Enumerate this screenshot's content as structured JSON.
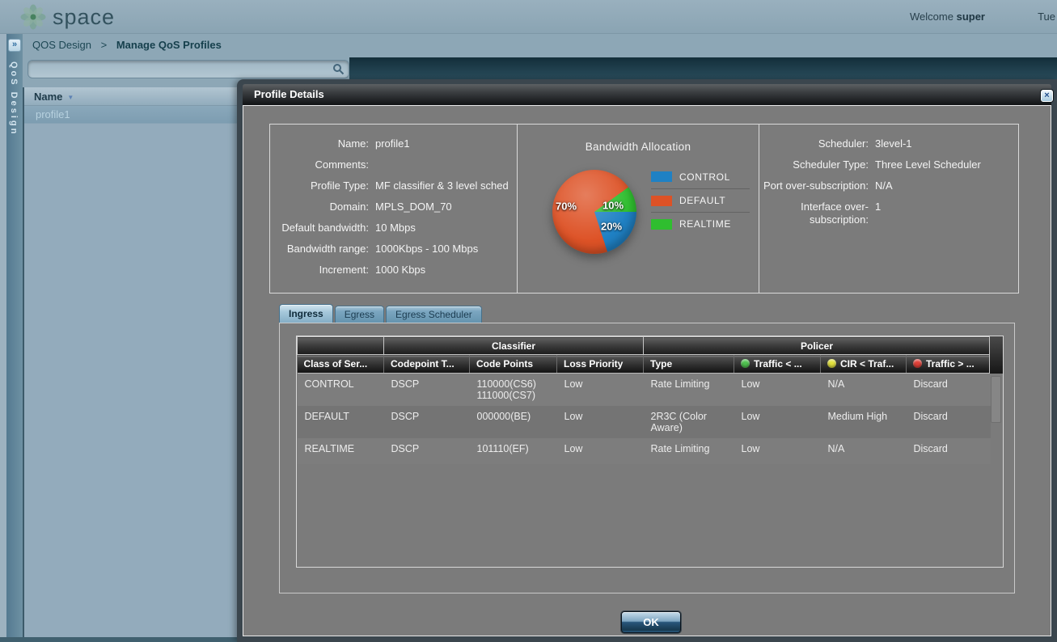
{
  "header": {
    "logo_text": "space",
    "welcome_label": "Welcome",
    "username": "super",
    "datetime": "Tue"
  },
  "breadcrumb": {
    "parent": "QOS Design",
    "separator": ">",
    "current": "Manage QoS Profiles"
  },
  "search": {
    "value": ""
  },
  "sidebar": {
    "expand_glyph": "»",
    "vertical_label": "QoS Design",
    "list_header": "Name",
    "sort_arrow": "▼",
    "items": [
      {
        "label": "profile1",
        "selected": true
      }
    ]
  },
  "modal": {
    "title": "Profile Details",
    "close_glyph": "×",
    "info_fields": [
      {
        "label": "Name:",
        "value": "profile1"
      },
      {
        "label": "Comments:",
        "value": ""
      },
      {
        "label": "Profile Type:",
        "value": "MF classifier & 3 level sched"
      },
      {
        "label": "Domain:",
        "value": "MPLS_DOM_70"
      },
      {
        "label": "Default bandwidth:",
        "value": "10 Mbps"
      },
      {
        "label": "Bandwidth range:",
        "value": "1000Kbps - 100 Mbps"
      },
      {
        "label": "Increment:",
        "value": "1000 Kbps"
      }
    ],
    "scheduler_fields": [
      {
        "label": "Scheduler:",
        "value": "3level-1"
      },
      {
        "label": "Scheduler Type:",
        "value": "Three Level Scheduler"
      },
      {
        "label": "Port over-subscription:",
        "value": "N/A"
      },
      {
        "label": "Interface over-subscription:",
        "value": "1"
      }
    ],
    "tabs": [
      {
        "label": "Ingress",
        "active": true
      },
      {
        "label": "Egress",
        "active": false
      },
      {
        "label": "Egress Scheduler",
        "active": false
      }
    ],
    "table": {
      "group_headers": [
        {
          "label": "",
          "span": 1
        },
        {
          "label": "Classifier",
          "span": 3
        },
        {
          "label": "Policer",
          "span": 4
        }
      ],
      "columns": [
        {
          "label": "Class of Ser..."
        },
        {
          "label": "Codepoint T..."
        },
        {
          "label": "Code Points"
        },
        {
          "label": "Loss Priority"
        },
        {
          "label": "Type"
        },
        {
          "label": "Traffic < ...",
          "dot_color": "#4fc24f"
        },
        {
          "label": "CIR < Traf...",
          "dot_color": "#e3e23e"
        },
        {
          "label": "Traffic > ...",
          "dot_color": "#e04038"
        }
      ],
      "rows": [
        {
          "cells": [
            "CONTROL",
            "DSCP",
            "110000(CS6)\n111000(CS7)",
            "Low",
            "Rate Limiting",
            "Low",
            "N/A",
            "Discard"
          ]
        },
        {
          "cells": [
            "DEFAULT",
            "DSCP",
            "000000(BE)",
            "Low",
            "2R3C (Color Aware)",
            "Low",
            "Medium High",
            "Discard"
          ]
        },
        {
          "cells": [
            "REALTIME",
            "DSCP",
            "101110(EF)",
            "Low",
            "Rate Limiting",
            "Low",
            "N/A",
            "Discard"
          ]
        }
      ]
    },
    "ok_label": "OK"
  },
  "chart_data": {
    "type": "pie",
    "title": "Bandwidth Allocation",
    "series": [
      {
        "label": "CONTROL",
        "value": 20,
        "percent_label": "20%",
        "color": "#1f81c4"
      },
      {
        "label": "DEFAULT",
        "value": 70,
        "percent_label": "70%",
        "color": "#dd5226"
      },
      {
        "label": "REALTIME",
        "value": 10,
        "percent_label": "10%",
        "color": "#2fbe2f"
      }
    ],
    "draw_order": [
      "REALTIME",
      "CONTROL",
      "DEFAULT"
    ],
    "start_angle_deg": 54,
    "legend_position": "right",
    "legend_entries": [
      "CONTROL",
      "DEFAULT",
      "REALTIME"
    ]
  }
}
